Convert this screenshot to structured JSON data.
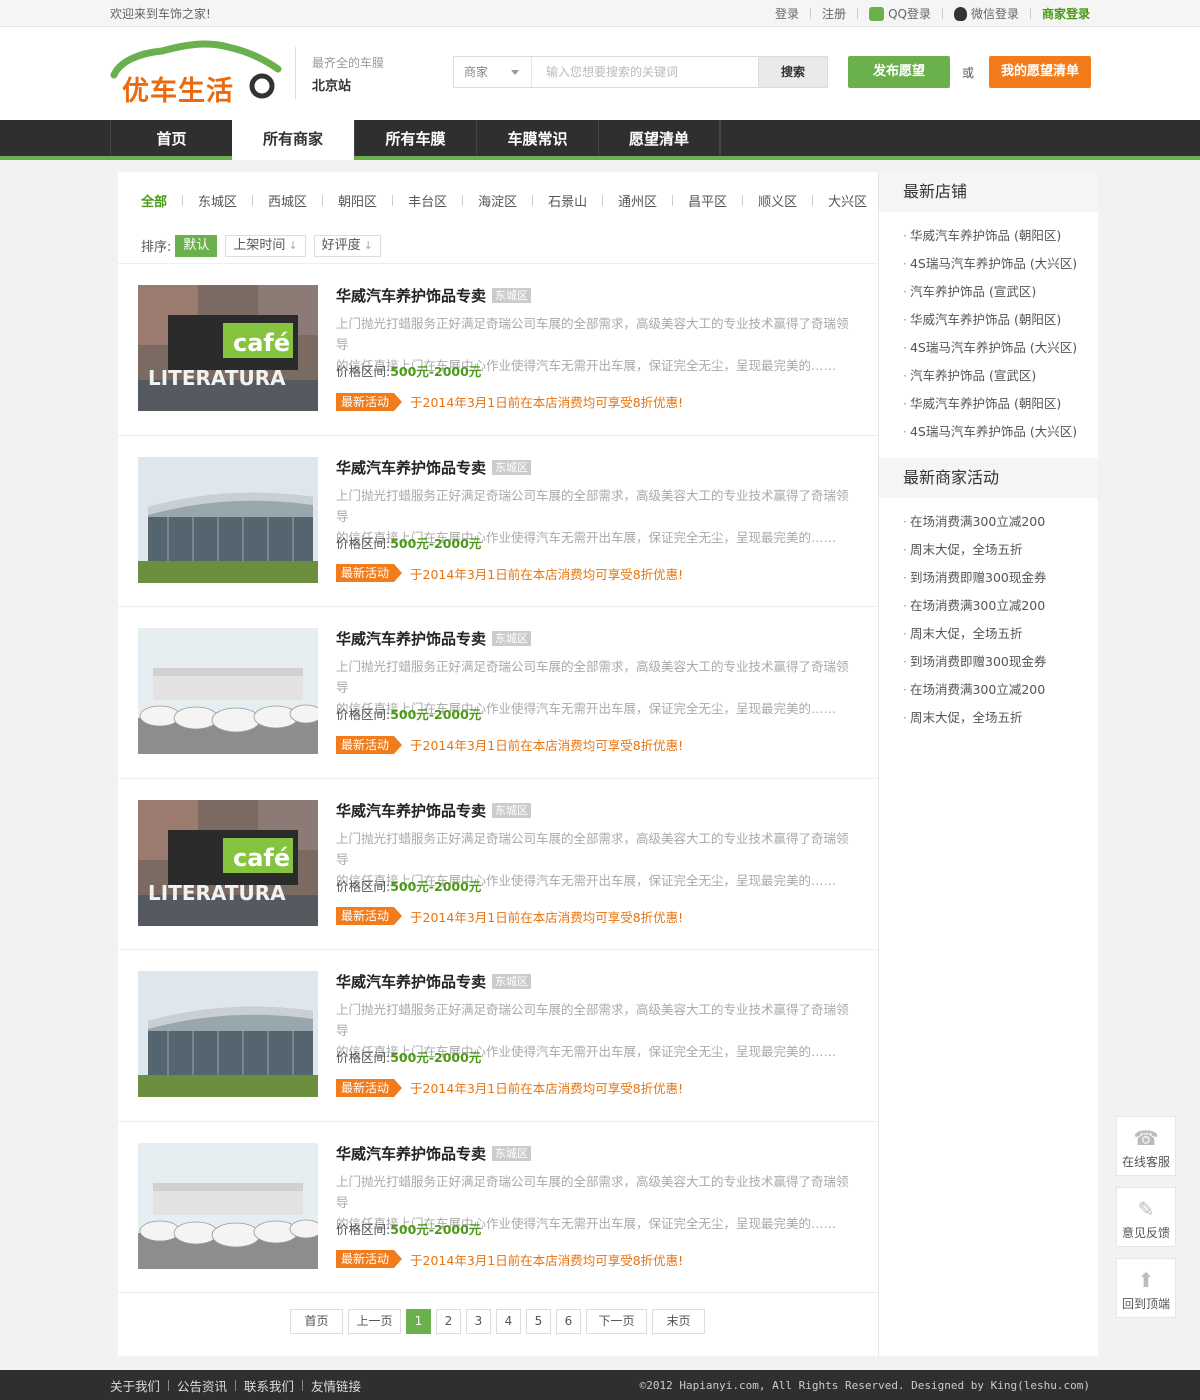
{
  "topbar": {
    "welcome": "欢迎来到车饰之家!",
    "login": "登录",
    "register": "注册",
    "qq_login": "QQ登录",
    "wechat_login": "微信登录",
    "merchant_login": "商家登录"
  },
  "header": {
    "logo_text": "优车生活",
    "slogan": "最齐全的车膜",
    "city": "北京站",
    "search_category": "商家",
    "search_placeholder": "输入您想要搜索的关键词",
    "search_button": "搜索",
    "post_button": "发布愿望",
    "or_text": "或",
    "wish_button": "我的愿望清单"
  },
  "nav": {
    "items": [
      "首页",
      "所有商家",
      "所有车膜",
      "车膜常识",
      "愿望清单"
    ],
    "active_index": 1
  },
  "filters": {
    "districts": [
      "全部",
      "东城区",
      "西城区",
      "朝阳区",
      "丰台区",
      "海淀区",
      "石景山",
      "通州区",
      "昌平区",
      "顺义区",
      "大兴区"
    ],
    "sort_label": "排序:",
    "sort_options": [
      "默认",
      "上架时间",
      "好评度"
    ]
  },
  "listings": [
    {
      "title": "华威汽车养护饰品专卖",
      "district": "东城区",
      "desc1": "上门抛光打蜡服务正好满足奇瑞公司车展的全部需求，高级美容大工的专业技术赢得了奇瑞领导",
      "desc2": "的信任直接上门在车展中心作业使得汽车无需开出车展，保证完全无尘，呈现最完美的……",
      "price_label": "价格区间:",
      "price": "500元-2000元",
      "promo_badge": "最新活动",
      "promo": "于2014年3月1日前在本店消费均可享受8折优惠!",
      "image": "cafe"
    },
    {
      "title": "华威汽车养护饰品专卖",
      "district": "东城区",
      "desc1": "上门抛光打蜡服务正好满足奇瑞公司车展的全部需求，高级美容大工的专业技术赢得了奇瑞领导",
      "desc2": "的信任直接上门在车展中心作业使得汽车无需开出车展，保证完全无尘，呈现最完美的……",
      "price_label": "价格区间:",
      "price": "500元-2000元",
      "promo_badge": "最新活动",
      "promo": "于2014年3月1日前在本店消费均可享受8折优惠!",
      "image": "building"
    },
    {
      "title": "华威汽车养护饰品专卖",
      "district": "东城区",
      "desc1": "上门抛光打蜡服务正好满足奇瑞公司车展的全部需求，高级美容大工的专业技术赢得了奇瑞领导",
      "desc2": "的信任直接上门在车展中心作业使得汽车无需开出车展，保证完全无尘，呈现最完美的……",
      "price_label": "价格区间:",
      "price": "500元-2000元",
      "promo_badge": "最新活动",
      "promo": "于2014年3月1日前在本店消费均可享受8折优惠!",
      "image": "cars"
    },
    {
      "title": "华威汽车养护饰品专卖",
      "district": "东城区",
      "desc1": "上门抛光打蜡服务正好满足奇瑞公司车展的全部需求，高级美容大工的专业技术赢得了奇瑞领导",
      "desc2": "的信任直接上门在车展中心作业使得汽车无需开出车展，保证完全无尘，呈现最完美的……",
      "price_label": "价格区间:",
      "price": "500元-2000元",
      "promo_badge": "最新活动",
      "promo": "于2014年3月1日前在本店消费均可享受8折优惠!",
      "image": "cafe"
    },
    {
      "title": "华威汽车养护饰品专卖",
      "district": "东城区",
      "desc1": "上门抛光打蜡服务正好满足奇瑞公司车展的全部需求，高级美容大工的专业技术赢得了奇瑞领导",
      "desc2": "的信任直接上门在车展中心作业使得汽车无需开出车展，保证完全无尘，呈现最完美的……",
      "price_label": "价格区间:",
      "price": "500元-2000元",
      "promo_badge": "最新活动",
      "promo": "于2014年3月1日前在本店消费均可享受8折优惠!",
      "image": "building"
    },
    {
      "title": "华威汽车养护饰品专卖",
      "district": "东城区",
      "desc1": "上门抛光打蜡服务正好满足奇瑞公司车展的全部需求，高级美容大工的专业技术赢得了奇瑞领导",
      "desc2": "的信任直接上门在车展中心作业使得汽车无需开出车展，保证完全无尘，呈现最完美的……",
      "price_label": "价格区间:",
      "price": "500元-2000元",
      "promo_badge": "最新活动",
      "promo": "于2014年3月1日前在本店消费均可享受8折优惠!",
      "image": "cars"
    }
  ],
  "pagination": {
    "first": "首页",
    "prev": "上一页",
    "pages": [
      "1",
      "2",
      "3",
      "4",
      "5",
      "6"
    ],
    "current": "1",
    "next": "下一页",
    "last": "末页"
  },
  "sidebar": {
    "shops_title": "最新店铺",
    "shops": [
      "华威汽车养护饰品 (朝阳区)",
      "4S瑞马汽车养护饰品 (大兴区)",
      "汽车养护饰品 (宣武区)",
      "华威汽车养护饰品 (朝阳区)",
      "4S瑞马汽车养护饰品 (大兴区)",
      "汽车养护饰品 (宣武区)",
      "华威汽车养护饰品 (朝阳区)",
      "4S瑞马汽车养护饰品 (大兴区)"
    ],
    "activities_title": "最新商家活动",
    "activities": [
      "在场消费满300立减200",
      "周末大促，全场五折",
      "到场消费即赠300现金券",
      "在场消费满300立减200",
      "周末大促，全场五折",
      "到场消费即赠300现金券",
      "在场消费满300立减200",
      "周末大促，全场五折"
    ]
  },
  "float_buttons": {
    "service": "在线客服",
    "feedback": "意见反馈",
    "top": "回到顶端"
  },
  "footer": {
    "links": [
      "关于我们",
      "公告资讯",
      "联系我们",
      "友情链接"
    ],
    "copyright": "©2012 Hapianyi.com, All Rights Reserved. Designed by King(leshu.com)"
  },
  "colors": {
    "brand_green": "#6ab04c",
    "brand_orange": "#f27b1b",
    "nav_dark": "#2f2f2f"
  }
}
